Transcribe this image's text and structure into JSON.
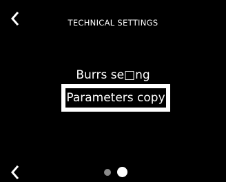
{
  "header": {
    "title": "TECHNICAL SETTINGS",
    "back_icon": "chevron-left-icon"
  },
  "menu": {
    "items": [
      {
        "label": "Burrs se□ng"
      },
      {
        "label": "Parameters copy",
        "selected": true
      }
    ]
  },
  "footer": {
    "back_icon": "chevron-left-icon",
    "pagination": {
      "total": 2,
      "current": 2
    }
  },
  "colors": {
    "background": "#000000",
    "text": "#ffffff",
    "dot_inactive": "#8a8a8a",
    "dot_active": "#ffffff"
  }
}
